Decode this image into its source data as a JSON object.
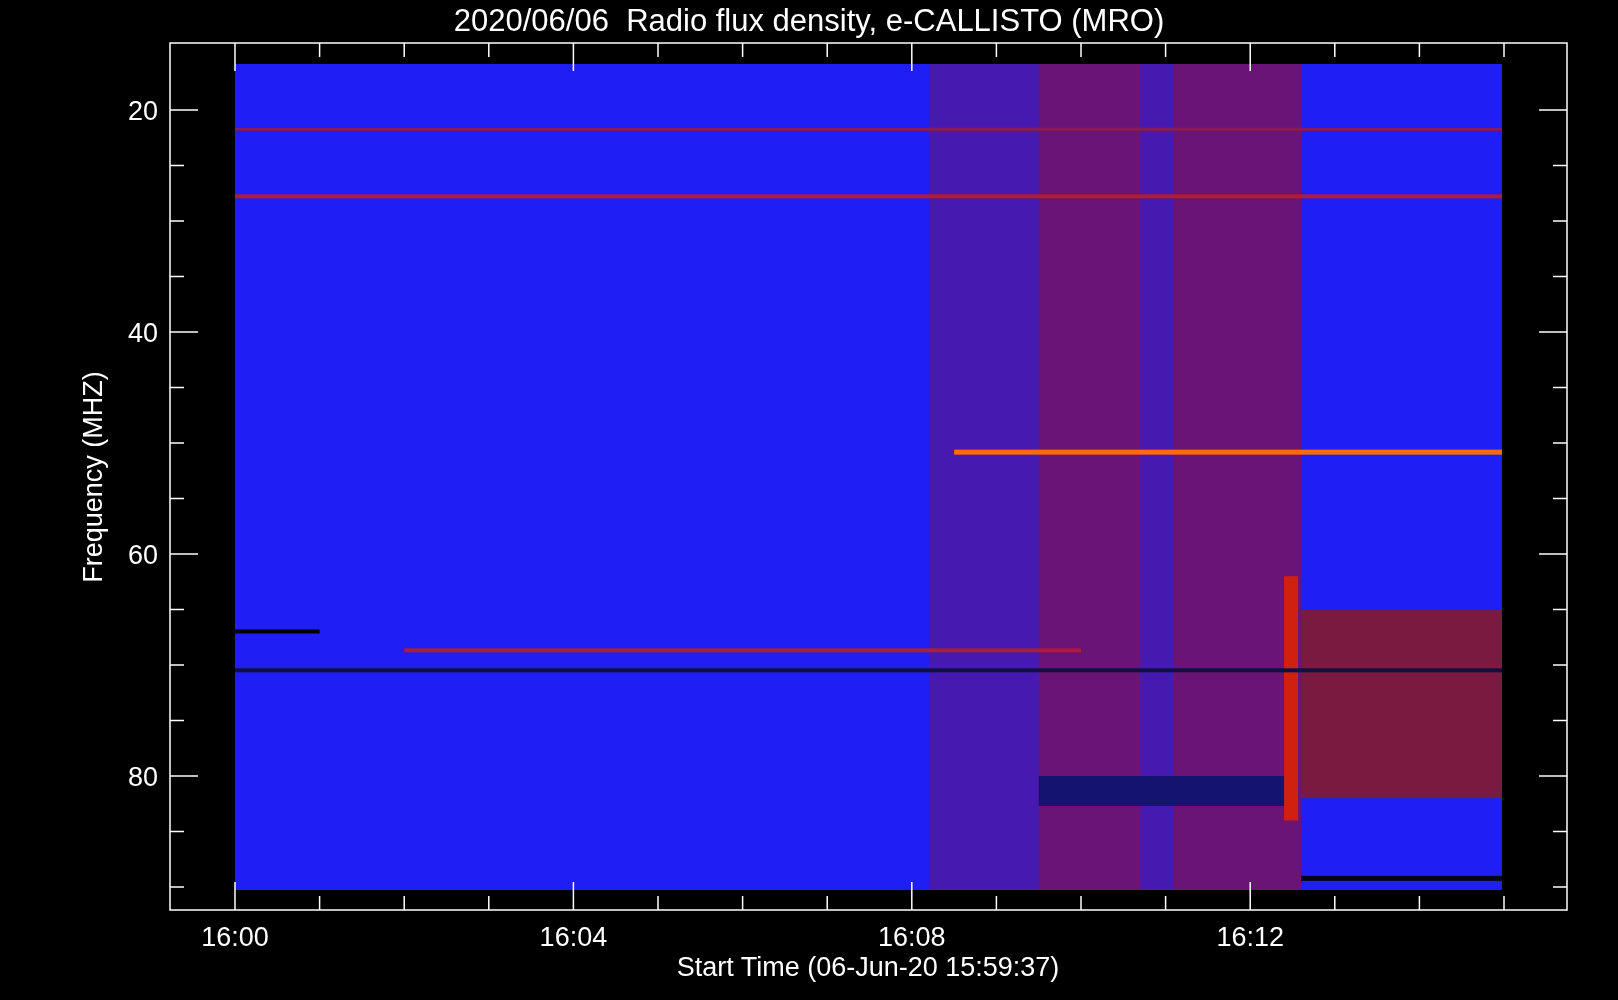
{
  "chart": {
    "title": "2020/06/06  Radio flux density, e-CALLISTO (MRO)",
    "ylabel": "Frequency (MHZ)",
    "xlabel": "Start Time (06-Jun-20 15:59:37)",
    "yticks": [
      "20",
      "40",
      "60",
      "80"
    ],
    "xticks": [
      "16:00",
      "16:04",
      "16:08",
      "16:12"
    ]
  }
}
